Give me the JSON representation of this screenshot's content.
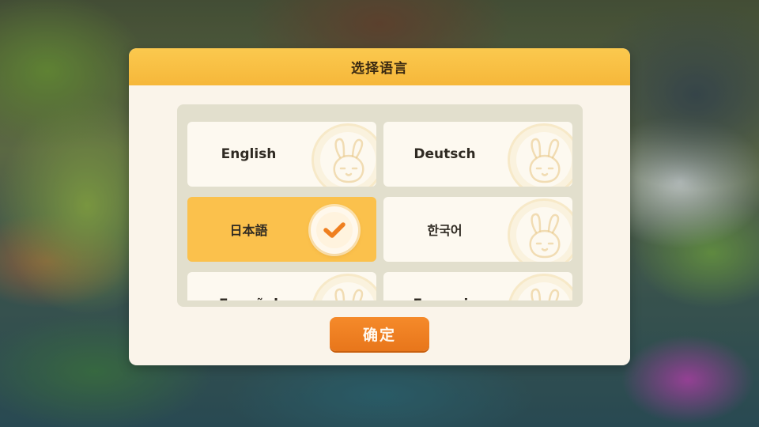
{
  "dialog": {
    "title": "选择语言",
    "confirm_label": "确定"
  },
  "languages": [
    {
      "label": "English",
      "selected": false
    },
    {
      "label": "Deutsch",
      "selected": false
    },
    {
      "label": "日本語",
      "selected": true
    },
    {
      "label": "한국어",
      "selected": false
    },
    {
      "label": "Español",
      "selected": false
    },
    {
      "label": "Français",
      "selected": false
    }
  ],
  "icons": {
    "card_decoration": "bunny-coin-icon",
    "selected_marker": "checkmark-icon"
  },
  "colors": {
    "header": "#f6b73a",
    "selected_card": "#fbc14c",
    "confirm_button": "#ee7f22",
    "panel": "#faf4ea"
  }
}
